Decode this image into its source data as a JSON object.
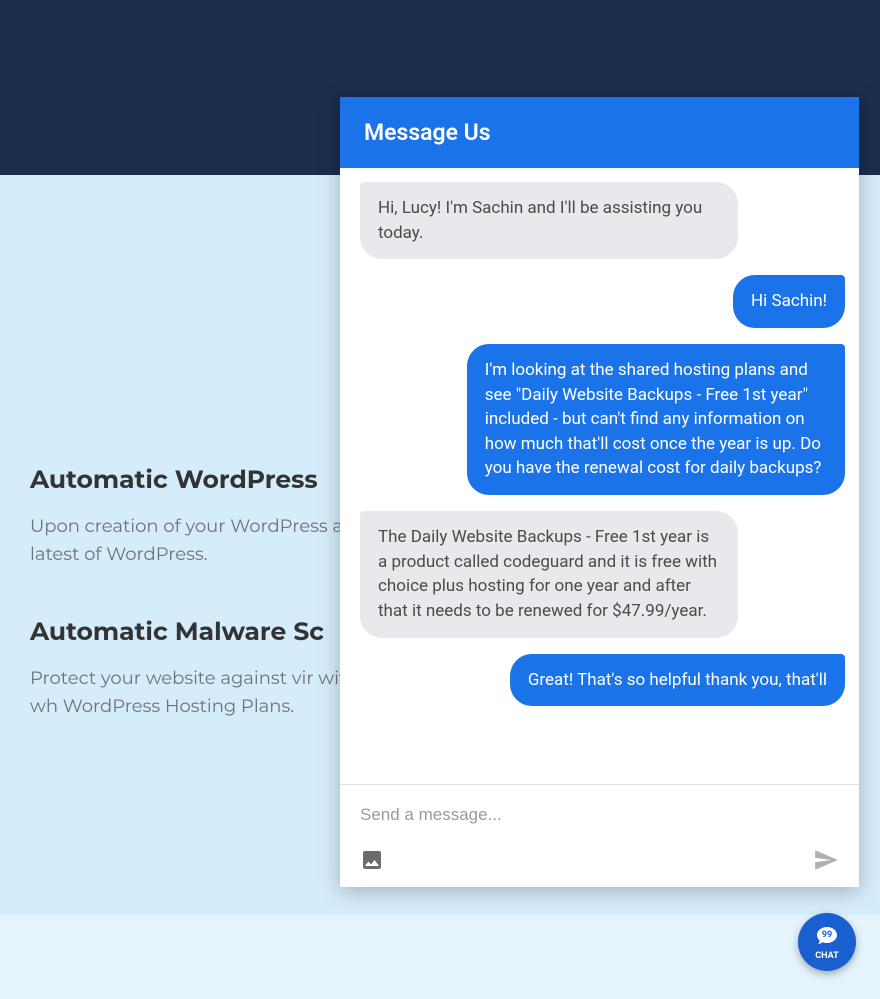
{
  "page": {
    "section1": {
      "heading": "Automatic WordPress",
      "body": "Upon creation of your WordPress automatically installs the latest of WordPress."
    },
    "section2": {
      "heading": "Automatic Malware Sc",
      "body": "Protect your website against vir with SiteLock Security Scans, wh WordPress Hosting Plans."
    }
  },
  "chat": {
    "header_title": "Message Us",
    "input_placeholder": "Send a message...",
    "messages": [
      {
        "role": "agent",
        "text": "Hi, Lucy! I'm Sachin and I'll be assisting you today."
      },
      {
        "role": "user",
        "text": "Hi Sachin!"
      },
      {
        "role": "user",
        "text": "I'm looking at the shared hosting plans and see \"Daily Website Backups - Free 1st year\" included - but can't find any information on how much that'll cost once the year is up. Do you have the renewal cost for daily backups?"
      },
      {
        "role": "agent",
        "text": "The Daily Website Backups - Free 1st year is a product called codeguard and it is free with choice plus hosting for one year and after that it needs to be renewed for $47.99/year."
      },
      {
        "role": "user",
        "text": "Great! That's so helpful thank you, that'll"
      }
    ]
  },
  "fab": {
    "label": "CHAT"
  },
  "colors": {
    "primary_blue": "#1a73e8",
    "dark_navy": "#1a2d4d",
    "light_blue_bg": "#d5ecfa"
  }
}
